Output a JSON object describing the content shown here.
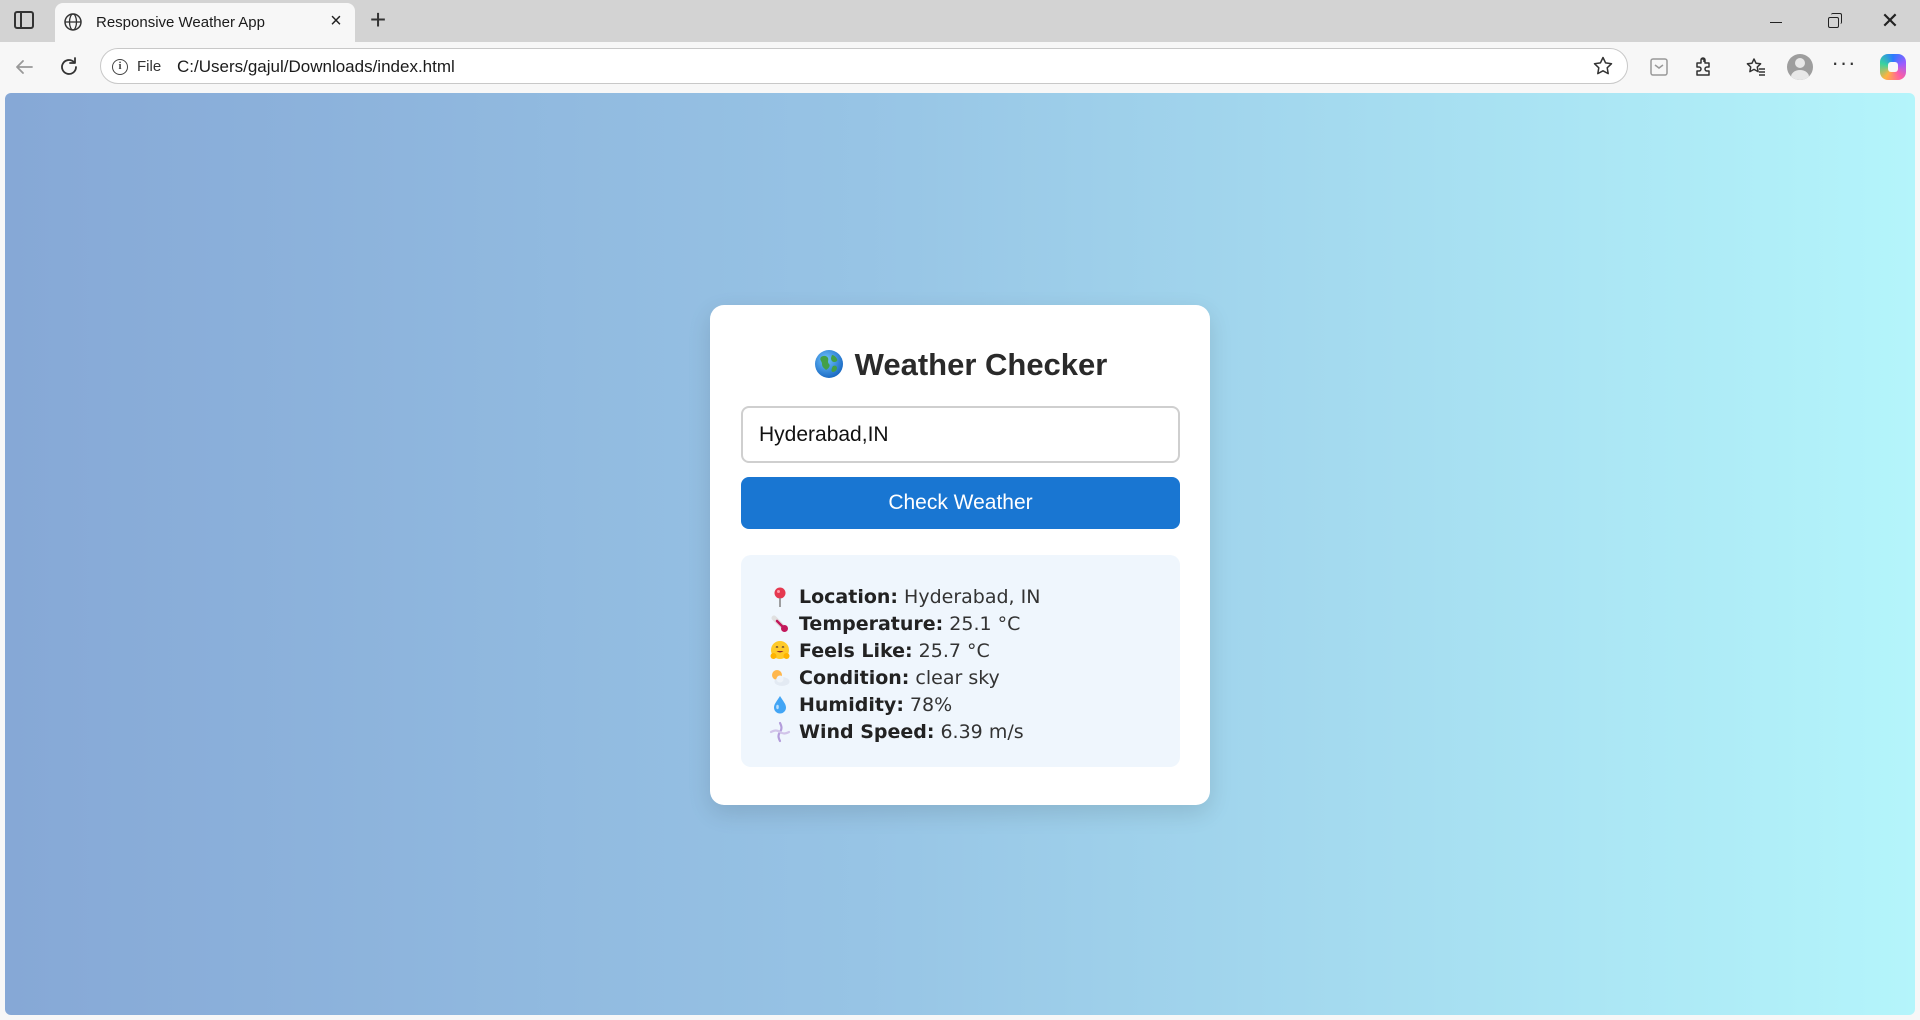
{
  "browser": {
    "tab_title": "Responsive Weather App",
    "address_prefix": "File",
    "url": "C:/Users/gajul/Downloads/index.html"
  },
  "app": {
    "title": "Weather Checker",
    "input_value": "Hyderabad,IN",
    "button_label": "Check Weather",
    "rows": [
      {
        "icon": "pin-icon",
        "label": "Location:",
        "value": "Hyderabad, IN"
      },
      {
        "icon": "thermometer-icon",
        "label": "Temperature:",
        "value": "25.1 °C"
      },
      {
        "icon": "hug-face-icon",
        "label": "Feels Like:",
        "value": "25.7 °C"
      },
      {
        "icon": "sun-cloud-icon",
        "label": "Condition:",
        "value": "clear sky"
      },
      {
        "icon": "droplet-icon",
        "label": "Humidity:",
        "value": "78%"
      },
      {
        "icon": "wind-icon",
        "label": "Wind Speed:",
        "value": "6.39 m/s"
      }
    ]
  },
  "colors": {
    "button": "#1976d2",
    "result_bg": "#eff6fd",
    "gradient_start": "#86a8d6",
    "gradient_end": "#b4f5fb"
  }
}
